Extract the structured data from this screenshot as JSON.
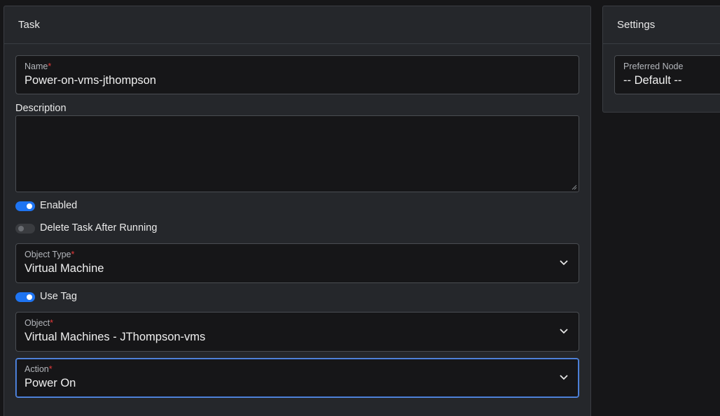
{
  "task_panel": {
    "title": "Task",
    "name_field": {
      "label": "Name",
      "required_mark": "*",
      "value": "Power-on-vms-jthompson"
    },
    "description": {
      "label": "Description",
      "value": ""
    },
    "enabled_toggle": {
      "label": "Enabled",
      "state": "on"
    },
    "delete_after_toggle": {
      "label": "Delete Task After Running",
      "state": "off"
    },
    "object_type_field": {
      "label": "Object Type",
      "required_mark": "*",
      "value": "Virtual Machine"
    },
    "use_tag_toggle": {
      "label": "Use Tag",
      "state": "on"
    },
    "object_field": {
      "label": "Object",
      "required_mark": "*",
      "value": "Virtual Machines - JThompson-vms"
    },
    "action_field": {
      "label": "Action",
      "required_mark": "*",
      "value": "Power On"
    }
  },
  "settings_panel": {
    "title": "Settings",
    "preferred_node": {
      "label": "Preferred Node",
      "value": "-- Default --"
    }
  },
  "colors": {
    "accent": "#1e74f2",
    "required": "#e53a3a",
    "focus_border": "#5b8fe6"
  },
  "icons": {
    "dropdown": "chevron-down-icon",
    "resize": "resize-grip-icon"
  }
}
